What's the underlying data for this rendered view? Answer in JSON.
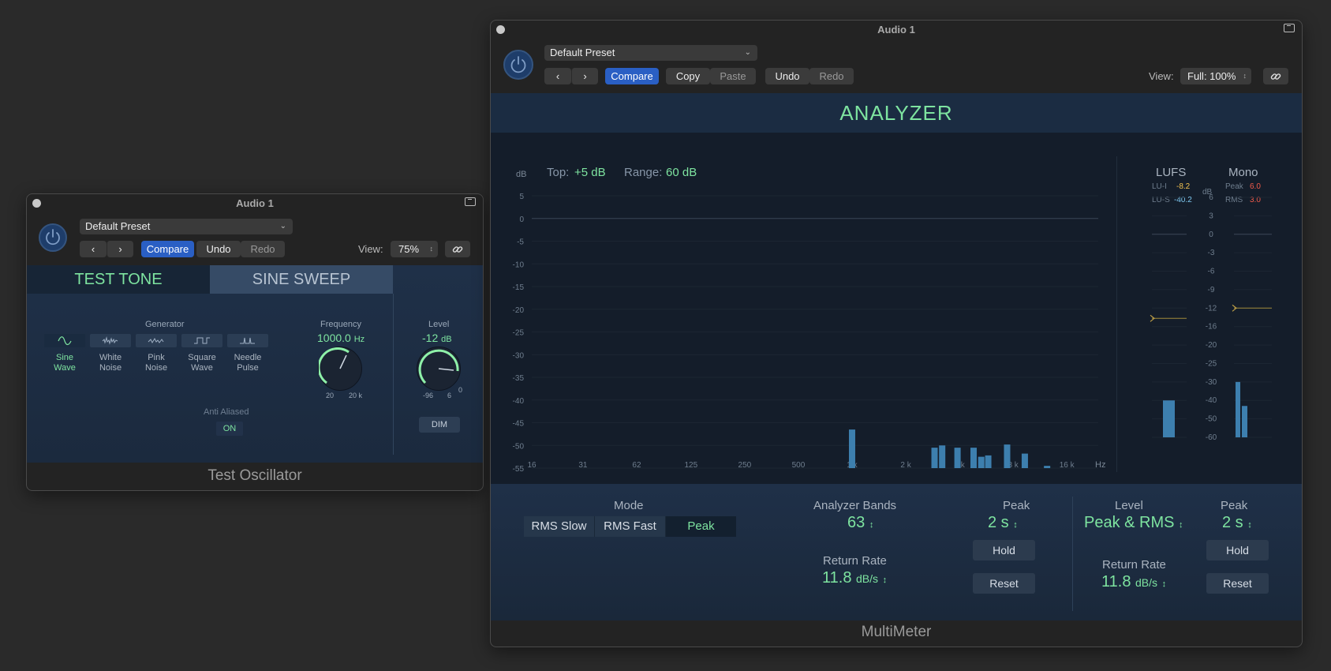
{
  "test_oscillator": {
    "window_title": "Audio 1",
    "preset": "Default Preset",
    "compare_label": "Compare",
    "undo_label": "Undo",
    "redo_label": "Redo",
    "view_label": "View:",
    "view_value": "75%",
    "tab_test_tone": "TEST TONE",
    "tab_sine_sweep": "SINE SWEEP",
    "generator_label": "Generator",
    "generators": [
      {
        "line1": "Sine",
        "line2": "Wave"
      },
      {
        "line1": "White",
        "line2": "Noise"
      },
      {
        "line1": "Pink",
        "line2": "Noise"
      },
      {
        "line1": "Square",
        "line2": "Wave"
      },
      {
        "line1": "Needle",
        "line2": "Pulse"
      }
    ],
    "selected_generator": "Sine Wave",
    "anti_aliased_label": "Anti Aliased",
    "anti_aliased_value": "ON",
    "frequency_label": "Frequency",
    "frequency_value": "1000.0",
    "frequency_unit": "Hz",
    "frequency_min": "20",
    "frequency_max": "20 k",
    "level_label": "Level",
    "level_value": "-12",
    "level_unit": "dB",
    "level_scale": [
      "-96",
      "6",
      "0"
    ],
    "dim_label": "DIM",
    "plugin_name": "Test Oscillator"
  },
  "multimeter": {
    "window_title": "Audio 1",
    "preset": "Default Preset",
    "compare_label": "Compare",
    "copy_label": "Copy",
    "paste_label": "Paste",
    "undo_label": "Undo",
    "redo_label": "Redo",
    "view_label": "View:",
    "view_value": "Full: 100%",
    "analyzer_title": "ANALYZER",
    "db_unit": "dB",
    "top_label": "Top:",
    "top_value": "+5 dB",
    "range_label": "Range:",
    "range_value": "60 dB",
    "hz_unit": "Hz",
    "lufs_title": "LUFS",
    "lu_i_label": "LU-I",
    "lu_i_value": "-8.2",
    "lu_s_label": "LU-S",
    "lu_s_value": "-40.2",
    "mono_title": "Mono",
    "peak_label": "Peak",
    "peak_value": "6.0",
    "rms_label": "RMS",
    "rms_value": "3.0",
    "meter_db_unit": "dB",
    "meter_scale": [
      "6",
      "3",
      "0",
      "-3",
      "-6",
      "-9",
      "-12",
      "-16",
      "-20",
      "-25",
      "-30",
      "-40",
      "-50",
      "-60"
    ],
    "mode_label": "Mode",
    "modes": [
      "RMS Slow",
      "RMS Fast",
      "Peak"
    ],
    "selected_mode": "Peak",
    "analyzer_bands_label": "Analyzer Bands",
    "analyzer_bands_value": "63",
    "return_rate_label": "Return Rate",
    "return_rate_value": "11.8",
    "return_rate_unit": "dB/s",
    "peak_hold_label": "Peak",
    "peak_hold_value": "2 s",
    "hold_label": "Hold",
    "reset_label": "Reset",
    "level_label": "Level",
    "level_value": "Peak & RMS",
    "level_peak_label": "Peak",
    "level_peak_value": "2 s",
    "level_return_rate_label": "Return Rate",
    "level_return_rate_value": "11.8",
    "level_return_rate_unit": "dB/s",
    "level_hold_label": "Hold",
    "level_reset_label": "Reset",
    "plugin_name": "MultiMeter",
    "lufs_bar_db": -40,
    "mono_peak_db": -30,
    "mono_rms_db": -43,
    "lufs_marker_db": -12,
    "mono_marker_db": -12
  },
  "chart_data": {
    "type": "bar",
    "title": "ANALYZER",
    "ylabel": "dB",
    "xlabel": "Hz",
    "ylim": [
      -55,
      5
    ],
    "y_ticks": [
      "5",
      "0",
      "-5",
      "-10",
      "-15",
      "-20",
      "-25",
      "-30",
      "-35",
      "-40",
      "-45",
      "-50",
      "-55"
    ],
    "x_ticks": [
      "16",
      "31",
      "62",
      "125",
      "250",
      "500",
      "1 k",
      "2 k",
      "4 k",
      "8 k",
      "16 k"
    ],
    "bars": [
      {
        "x": 1000,
        "y": -46.5
      },
      {
        "x": 2900,
        "y": -50.5
      },
      {
        "x": 3200,
        "y": -50
      },
      {
        "x": 3900,
        "y": -50.5
      },
      {
        "x": 4800,
        "y": -50.5
      },
      {
        "x": 5300,
        "y": -52.5
      },
      {
        "x": 5800,
        "y": -52.2
      },
      {
        "x": 7400,
        "y": -49.8
      },
      {
        "x": 9300,
        "y": -51.8
      },
      {
        "x": 12400,
        "y": -54.5
      }
    ]
  }
}
